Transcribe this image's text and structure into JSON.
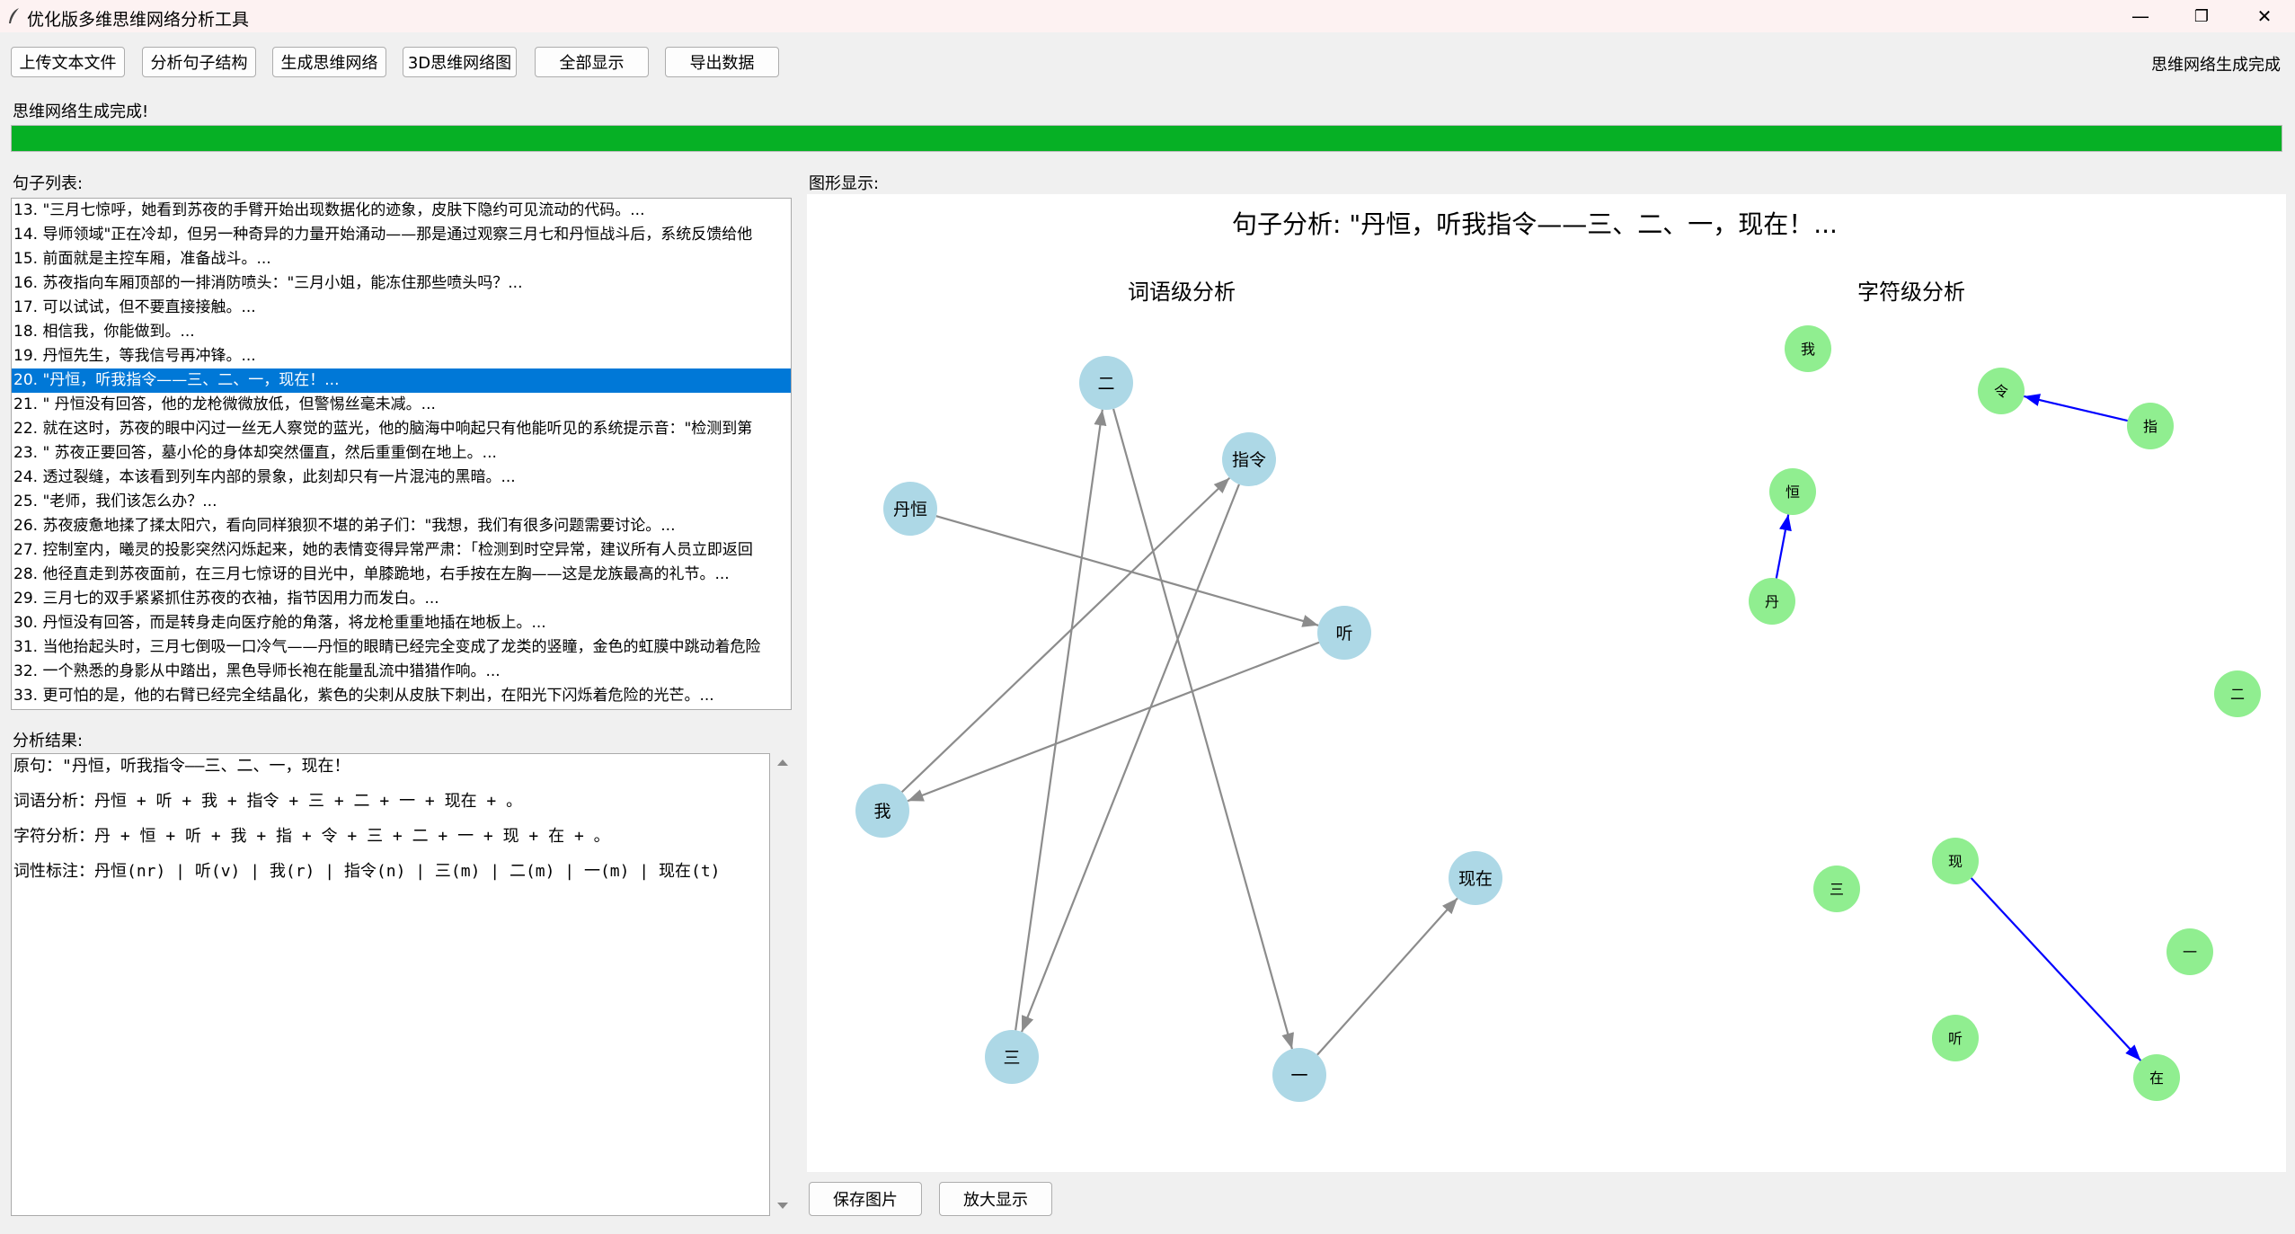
{
  "window": {
    "title": "优化版多维思维网络分析工具",
    "minimize": "—",
    "restore": "❐",
    "close": "✕"
  },
  "toolbar": {
    "buttons": [
      "上传文本文件",
      "分析句子结构",
      "生成思维网络",
      "3D思维网络图",
      "全部显示",
      "导出数据"
    ],
    "status": "思维网络生成完成"
  },
  "progress": {
    "label": "思维网络生成完成!",
    "value_percent": 100,
    "color": "#06b025"
  },
  "sentence_list": {
    "label": "句子列表:",
    "selected_index": 7,
    "items": [
      "13. \"三月七惊呼，她看到苏夜的手臂开始出现数据化的迹象，皮肤下隐约可见流动的代码。...",
      "14. 导师领域\"正在冷却，但另一种奇异的力量开始涌动——那是通过观察三月七和丹恒战斗后，系统反馈给他",
      "15. 前面就是主控车厢，准备战斗。...",
      "16. 苏夜指向车厢顶部的一排消防喷头：\"三月小姐，能冻住那些喷头吗？...",
      "17. 可以试试，但不要直接接触。...",
      "18. 相信我，你能做到。...",
      "19. 丹恒先生，等我信号再冲锋。...",
      "20. \"丹恒，听我指令——三、二、一，现在！...",
      "21. \" 丹恒没有回答，他的龙枪微微放低，但警惕丝毫未减。...",
      "22. 就在这时，苏夜的眼中闪过一丝无人察觉的蓝光，他的脑海中响起只有他能听见的系统提示音：\"检测到第",
      "23. \" 苏夜正要回答，墓小伦的身体却突然僵直，然后重重倒在地上。...",
      "24. 透过裂缝，本该看到列车内部的景象，此刻却只有一片混沌的黑暗。...",
      "25. \"老师，我们该怎么办？...",
      "26. 苏夜疲惫地揉了揉太阳穴，看向同样狼狈不堪的弟子们：\"我想，我们有很多问题需要讨论。...",
      "27. 控制室内，曦灵的投影突然闪烁起来，她的表情变得异常严肃：「检测到时空异常，建议所有人员立即返回",
      "28. 他径直走到苏夜面前，在三月七惊讶的目光中，单膝跪地，右手按在左胸——这是龙族最高的礼节。...",
      "29. 三月七的双手紧紧抓住苏夜的衣袖，指节因用力而发白。...",
      "30. 丹恒没有回答，而是转身走向医疗舱的角落，将龙枪重重地插在地板上。...",
      "31. 当他抬起头时，三月七倒吸一口冷气——丹恒的眼睛已经完全变成了龙类的竖瞳，金色的虹膜中跳动着危险",
      "32. 一个熟悉的身影从中踏出，黑色导师长袍在能量乱流中猎猎作响。...",
      "33. 更可怕的是，他的右臂已经完全结晶化，紫色的尖刺从皮肤下刺出，在阳光下闪烁着危险的光芒。..."
    ]
  },
  "analysis": {
    "label": "分析结果:",
    "lines": [
      "原句：\"丹恒，听我指令——三、二、一，现在！",
      "词语分析：丹恒 + 听 + 我 + 指令 + 三 + 二 + 一 + 现在 + 。",
      "字符分析：丹 + 恒 + 听 + 我 + 指 + 令 + 三 + 二 + 一 + 现 + 在 + 。",
      "词性标注：丹恒(nr) | 听(v) | 我(r) | 指令(n) | 三(m) | 二(m) | 一(m) | 现在(t)"
    ]
  },
  "graph": {
    "label": "图形显示:",
    "title": "句子分析: \"丹恒，听我指令——三、二、一，现在！...",
    "word_panel": {
      "title": "词语级分析",
      "node_color": "#add8e6",
      "edge_color": "#8c8c8c",
      "nodes": [
        "二",
        "指令",
        "丹恒",
        "听",
        "我",
        "现在",
        "三",
        "一"
      ],
      "edges": [
        [
          "丹恒",
          "听"
        ],
        [
          "听",
          "我"
        ],
        [
          "我",
          "指令"
        ],
        [
          "指令",
          "三"
        ],
        [
          "三",
          "二"
        ],
        [
          "二",
          "一"
        ],
        [
          "一",
          "现在"
        ]
      ]
    },
    "char_panel": {
      "title": "字符级分析",
      "node_color": "#90ee90",
      "edge_color": "#0000ff",
      "nodes": [
        "我",
        "令",
        "指",
        "恒",
        "丹",
        "二",
        "现",
        "三",
        "一",
        "听",
        "在"
      ],
      "edges": [
        [
          "丹",
          "恒"
        ],
        [
          "指",
          "令"
        ],
        [
          "现",
          "在"
        ]
      ]
    }
  },
  "bottom_buttons": [
    "保存图片",
    "放大显示"
  ]
}
